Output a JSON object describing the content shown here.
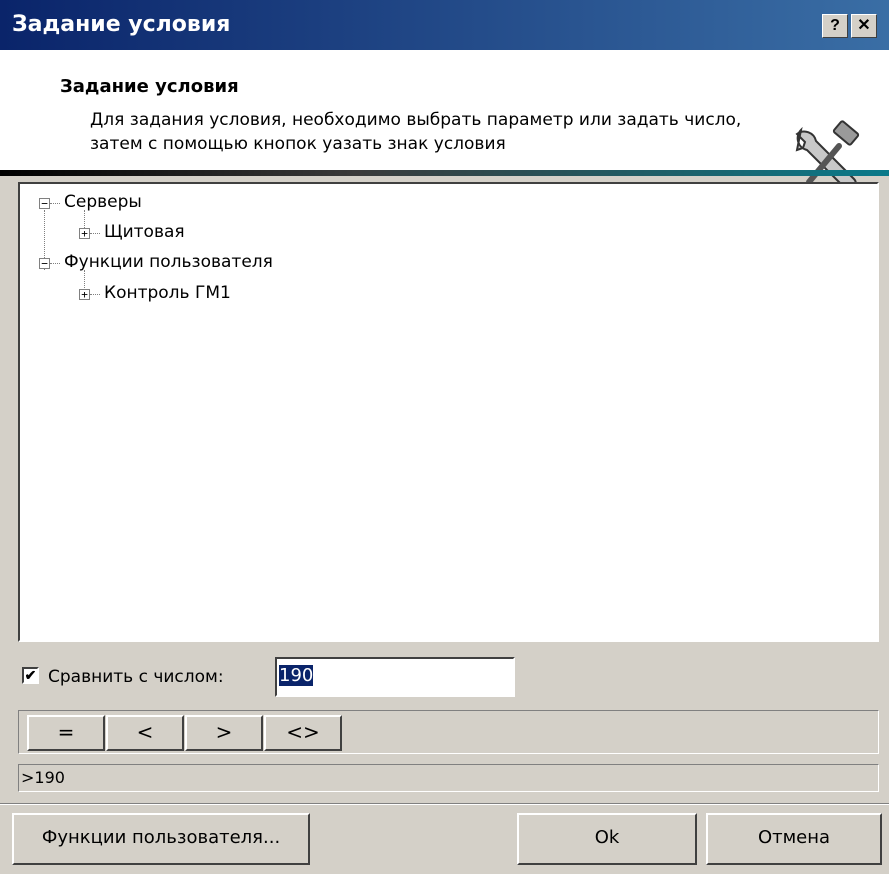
{
  "window": {
    "title": "Задание условия",
    "help_label": "?",
    "close_label": "✕"
  },
  "header": {
    "title": "Задание условия",
    "description": "Для задания условия, необходимо выбрать параметр или задать число, затем с помощью кнопок уазать знак условия",
    "icon": "tools-icon"
  },
  "tree": {
    "nodes": [
      {
        "label": "Серверы",
        "expander": "−"
      },
      {
        "label": "Щитовая",
        "expander": "+"
      },
      {
        "label": "Функции пользователя",
        "expander": "−"
      },
      {
        "label": "Контроль ГМ1",
        "expander": "+"
      }
    ]
  },
  "compare": {
    "checkbox_mark": "✔",
    "checked": true,
    "label": "Сравнить с числом:",
    "value": "190"
  },
  "operators": [
    "=",
    "<",
    ">",
    "<>"
  ],
  "result": ">190",
  "buttons": {
    "user_functions": "Функции пользователя...",
    "ok": "Ok",
    "cancel": "Отмена"
  }
}
